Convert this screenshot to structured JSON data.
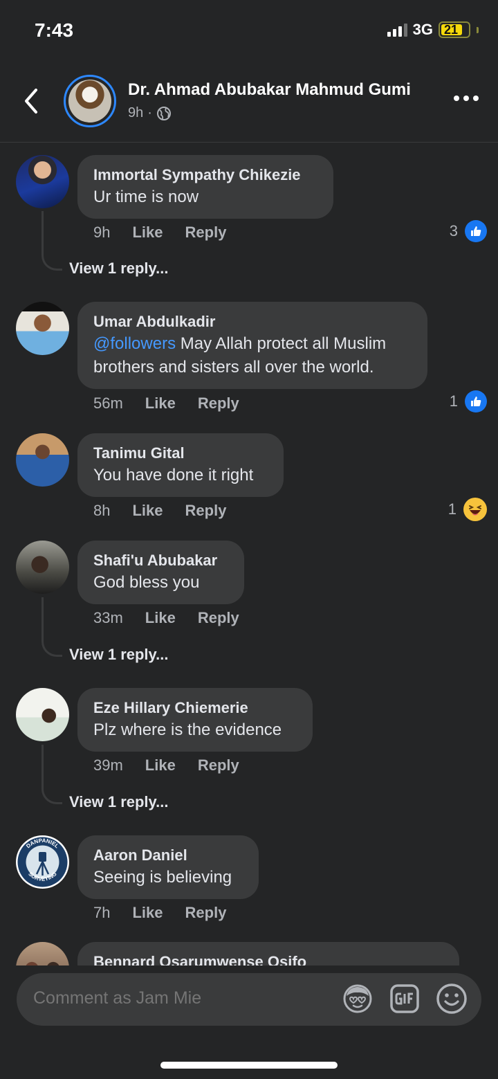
{
  "status_bar": {
    "time": "7:43",
    "network": "3G",
    "battery": "21"
  },
  "header": {
    "name": "Dr. Ahmad Abubakar Mahmud Gumi",
    "time": "9h",
    "separator": "·"
  },
  "comments": [
    {
      "name": "Immortal Sympathy Chikezie",
      "text": "Ur time is now",
      "time": "9h",
      "like": "Like",
      "reply": "Reply",
      "reaction_count": "3",
      "reaction": "like",
      "view_replies": "View 1 reply..."
    },
    {
      "name": "Umar Abdulkadir",
      "mention": "@followers",
      "text": " May Allah protect all Muslim brothers and sisters all over the world.",
      "time": "56m",
      "like": "Like",
      "reply": "Reply",
      "reaction_count": "1",
      "reaction": "like"
    },
    {
      "name": "Tanimu Gital",
      "text": "You have done it right",
      "time": "8h",
      "like": "Like",
      "reply": "Reply",
      "reaction_count": "1",
      "reaction": "haha"
    },
    {
      "name": "Shafi'u Abubakar",
      "text": "God bless you",
      "time": "33m",
      "like": "Like",
      "reply": "Reply",
      "view_replies": "View 1 reply..."
    },
    {
      "name": "Eze Hillary Chiemerie",
      "text": "Plz where is the evidence",
      "time": "39m",
      "like": "Like",
      "reply": "Reply",
      "view_replies": "View 1 reply..."
    },
    {
      "name": "Aaron Daniel",
      "text": "Seeing is believing",
      "time": "7h",
      "like": "Like",
      "reply": "Reply",
      "avatar_text_top": "DANPANIEL",
      "avatar_text_bottom": "SURVEYING"
    },
    {
      "name": "Bennard Osarumwense Osifo"
    }
  ],
  "composer": {
    "placeholder": "Comment as Jam Mie"
  },
  "colors": {
    "background": "#242526",
    "bubble": "#3a3b3c",
    "accent": "#1877f2",
    "mention": "#4599ff",
    "secondary_text": "#b0b3b8"
  },
  "icons": [
    "back-icon",
    "globe-icon",
    "more-icon",
    "like-icon",
    "haha-icon",
    "avatar-sticker-icon",
    "gif-icon",
    "emoji-icon"
  ]
}
